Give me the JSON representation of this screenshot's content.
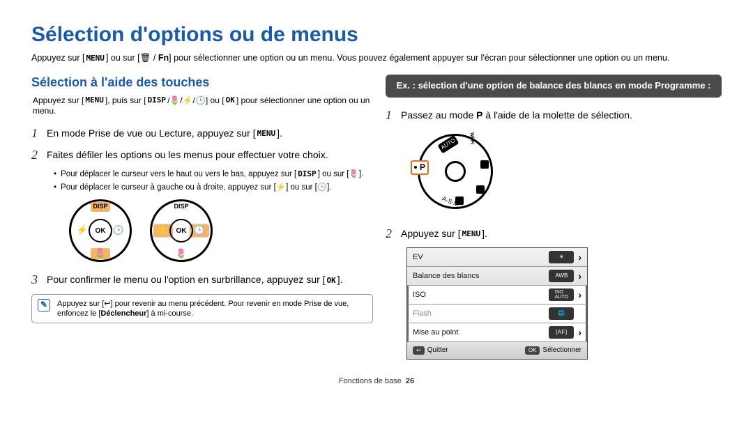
{
  "title": "Sélection d'options ou de menus",
  "intro_a": "Appuyez sur [",
  "intro_menu": "MENU",
  "intro_b": "] ou sur [🗑 / ",
  "intro_fn": "Fn",
  "intro_c": "] pour sélectionner une option ou un menu. Vous pouvez également appuyer sur l'écran pour sélectionner une option ou un menu.",
  "left": {
    "subtitle": "Sélection à l'aide des touches",
    "lead_a": "Appuyez sur [",
    "lead_b": "], puis sur [",
    "lead_disp": "DISP",
    "lead_c": "/🌷/⚡/🕒] ou [",
    "lead_ok": "OK",
    "lead_d": "] pour sélectionner une option ou un menu.",
    "step1_a": "En mode Prise de vue ou Lecture, appuyez sur [",
    "step1_b": "].",
    "step2": "Faites défiler les options ou les menus pour effectuer votre choix.",
    "b1_a": "Pour déplacer le curseur vers le haut ou vers le bas, appuyez sur [",
    "b1_b": "] ou sur [🌷].",
    "b2": "Pour déplacer le curseur à gauche ou à droite, appuyez sur [⚡] ou sur [🕒].",
    "step3_a": "Pour confirmer le menu ou l'option en surbrillance, appuyez sur [",
    "step3_b": "].",
    "note_a": "Appuyez sur [↩] pour revenir au menu précédent. Pour revenir en mode Prise de vue, enfoncez le [",
    "note_decl": "Déclencheur",
    "note_b": "] à mi-course.",
    "dial": {
      "disp": "DISP",
      "ok": "OK",
      "left": "⚡",
      "right": "🕒",
      "bottom": "🌷"
    }
  },
  "right": {
    "ex_label": "Ex. : sélection d'une option de balance des blancs en mode Programme :",
    "step1_a": "Passez au mode ",
    "step1_p": "P",
    "step1_b": " à l'aide de la molette de sélection.",
    "step2_a": "Appuyez sur [",
    "step2_b": "].",
    "modedial": {
      "auto": "AUTO",
      "wifi": "Wi-Fi",
      "asm": "A·S·M",
      "p": "P"
    },
    "lcd": {
      "rows": [
        {
          "label": "EV",
          "icon": "☀"
        },
        {
          "label": "Balance des blancs",
          "icon": "AWB"
        },
        {
          "label": "ISO",
          "icon": "ISO"
        },
        {
          "label": "Flash",
          "icon": "globe",
          "disabled": true
        },
        {
          "label": "Mise au point",
          "icon": "AF▸"
        }
      ],
      "footer": {
        "quit_icon": "↩",
        "quit": "Quitter",
        "sel_icon": "OK",
        "sel": "Sélectionner"
      }
    }
  },
  "footer": {
    "section": "Fonctions de base",
    "page": "26"
  }
}
